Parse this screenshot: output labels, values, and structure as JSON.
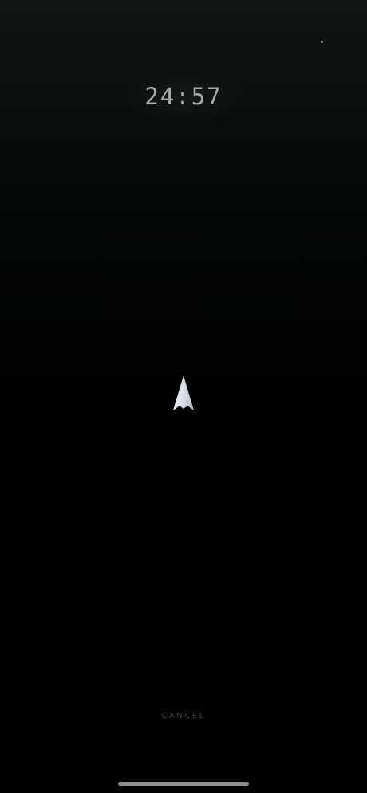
{
  "session": {
    "timer_text": "24:57",
    "cancel_label": "CANCEL"
  },
  "icons": {
    "ship": "arrowhead-rocket-icon"
  },
  "colors": {
    "background_top": "#121615",
    "background_bottom": "#000000",
    "timer_text": "#a7aaa9",
    "ship_fill": "#d9dbe6",
    "cancel_text": "#3c3f3e",
    "home_indicator": "#8d8f8e"
  }
}
